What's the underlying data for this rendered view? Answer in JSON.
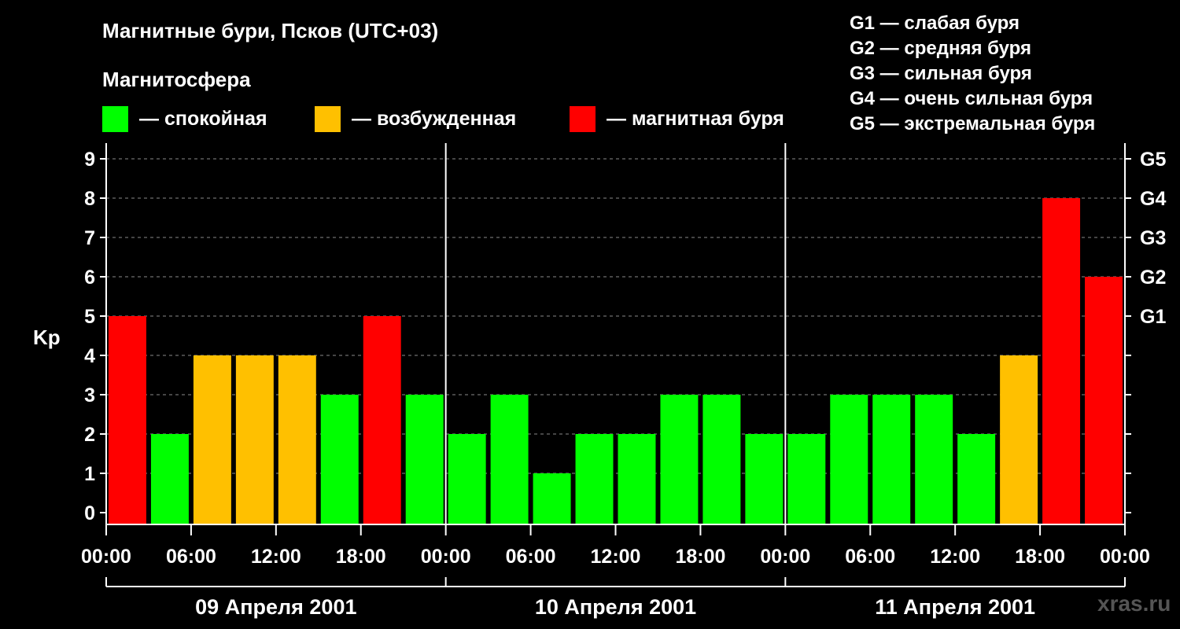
{
  "chart_data": {
    "type": "bar",
    "title": "Магнитные бури, Псков (UTC+03)",
    "ylabel": "Kp",
    "ylim": [
      0,
      9
    ],
    "yticks": [
      "0",
      "1",
      "2",
      "3",
      "4",
      "5",
      "6",
      "7",
      "8",
      "9"
    ],
    "right_axis": [
      {
        "value": 5,
        "label": "G1"
      },
      {
        "value": 6,
        "label": "G2"
      },
      {
        "value": 7,
        "label": "G3"
      },
      {
        "value": 8,
        "label": "G4"
      },
      {
        "value": 9,
        "label": "G5"
      }
    ],
    "xticks": [
      "00:00",
      "06:00",
      "12:00",
      "18:00",
      "00:00",
      "06:00",
      "12:00",
      "18:00",
      "00:00",
      "06:00",
      "12:00",
      "18:00",
      "00:00"
    ],
    "days": [
      "09 Апреля 2001",
      "10 Апреля 2001",
      "11 Апреля 2001"
    ],
    "values": [
      5,
      2,
      4,
      4,
      4,
      3,
      5,
      3,
      2,
      3,
      1,
      2,
      2,
      3,
      3,
      2,
      2,
      3,
      3,
      3,
      2,
      4,
      8,
      6
    ],
    "grid": "dashed horizontal",
    "legend": {
      "title": "Магнитосфера",
      "items": [
        {
          "label": "— спокойная",
          "color": "#00ff00"
        },
        {
          "label": "— возбужденная",
          "color": "#ffc000"
        },
        {
          "label": "— магнитная буря",
          "color": "#ff0000"
        }
      ]
    },
    "storm_levels": [
      "G1 — слабая буря",
      "G2 — средняя буря",
      "G3 — сильная буря",
      "G4 — очень сильная буря",
      "G5 — экстремальная буря"
    ]
  },
  "colors": {
    "quiet": "#00ff00",
    "active": "#ffc000",
    "storm": "#ff0000"
  },
  "watermark": "xras.ru"
}
